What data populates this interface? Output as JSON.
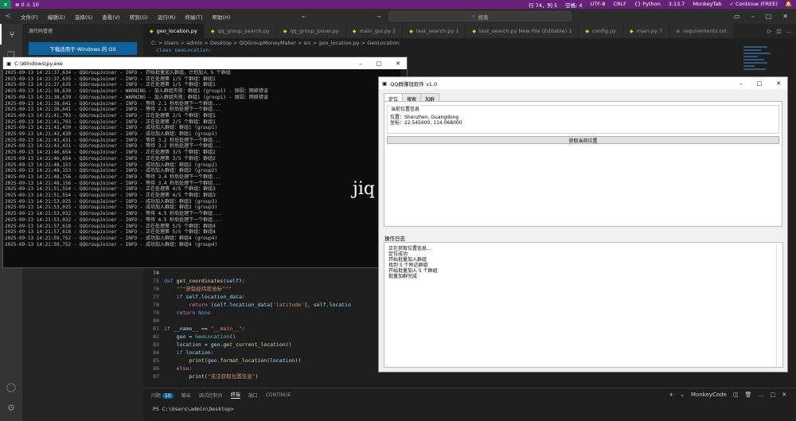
{
  "statusbar": {
    "left": [
      "⊗ 0 ⚠ 10"
    ],
    "right": [
      "行 74，列 5",
      "空格: 4",
      "UTF-8",
      "CRLF",
      "{} Python",
      "3.13.7",
      "MonkeyTab",
      "✓ Continue (FREE)",
      "🔔"
    ]
  },
  "titlebar": {
    "menus": [
      "文件(F)",
      "编辑(E)",
      "选择(S)",
      "查看(V)",
      "转到(G)",
      "运行(R)",
      "终端(T)",
      "帮助(H)"
    ],
    "search_text": "搜索",
    "nav_back": "←",
    "nav_forward": "→"
  },
  "sidebar": {
    "title": "源代码管理",
    "git_button": "下载适用于 Windows 的 Git"
  },
  "tabs": [
    {
      "label": "geo_location.py",
      "active": true,
      "icon": "python-icon"
    },
    {
      "label": "qq_group_search.py",
      "active": false,
      "icon": "python-icon"
    },
    {
      "label": "qq_group_joiner.py",
      "active": false,
      "icon": "python-icon"
    },
    {
      "label": "main_gui.py 2",
      "active": false,
      "icon": "python-icon"
    },
    {
      "label": "test_search.py 1",
      "active": false,
      "icon": "python-icon"
    },
    {
      "label": "test_search.py New File (Editable) 1",
      "active": false,
      "icon": "python-icon"
    },
    {
      "label": "config.py",
      "active": false,
      "icon": "python-icon"
    },
    {
      "label": "main.py 7",
      "active": false,
      "icon": "python-icon"
    },
    {
      "label": "requirements.txt",
      "active": false,
      "icon": "file-icon"
    }
  ],
  "breadcrumb": "C: > Users > admin > Desktop > QQGroupMoneyMaker > src > geo_location.py > GeoLocation",
  "code_top": "class GeoLocation:",
  "editor_lines": [
    {
      "num": "74",
      "html": ""
    },
    {
      "num": "75",
      "html": "<span class=\"k-def\">def</span> <span class=\"k-fn\">get_coordinates</span>(<span class=\"k-var\">self</span>):"
    },
    {
      "num": "76",
      "html": "    <span class=\"k-str\">\"\"\"获取经纬度坐标\"\"\"</span>"
    },
    {
      "num": "77",
      "html": "    <span class=\"k-ctl\">if</span> <span class=\"k-var\">self</span>.<span class=\"k-var\">location_data</span>:"
    },
    {
      "num": "78",
      "html": "        <span class=\"k-ctl\">return</span> (<span class=\"k-var\">self</span>.<span class=\"k-var\">location_data</span>[<span class=\"k-str\">'latitude'</span>], <span class=\"k-var\">self</span>.<span class=\"k-var\">locatio</span>"
    },
    {
      "num": "79",
      "html": "    <span class=\"k-ctl\">return</span> <span class=\"k-def\">None</span>"
    },
    {
      "num": "80",
      "html": ""
    },
    {
      "num": "81",
      "html": "<span class=\"k-ctl\">if</span> <span class=\"k-var\">__name__</span> == <span class=\"k-str\">\"__main__\"</span>:"
    },
    {
      "num": "82",
      "html": "    <span class=\"k-var\">geo</span> = <span class=\"k-cls\">GeoLocation</span>()"
    },
    {
      "num": "83",
      "html": "    <span class=\"k-var\">location</span> = <span class=\"k-var\">geo</span>.<span class=\"k-fn\">get_current_location</span>()"
    },
    {
      "num": "84",
      "html": "    <span class=\"k-ctl\">if</span> <span class=\"k-var\">location</span>:"
    },
    {
      "num": "85",
      "html": "        <span class=\"k-fn\">print</span>(<span class=\"k-var\">geo</span>.<span class=\"k-fn\">format_location</span>(<span class=\"k-var\">location</span>))"
    },
    {
      "num": "86",
      "html": "    <span class=\"k-ctl\">else</span>:"
    },
    {
      "num": "87",
      "html": "        <span class=\"k-fn\">print</span>(<span class=\"k-str\">\"无法获取位置信息\"</span>)"
    }
  ],
  "panel": {
    "tabs": [
      "问题",
      "输出",
      "调试控制台",
      "终端",
      "端口",
      "CONTINUE"
    ],
    "problems_badge": "10",
    "active_tab": 3,
    "right_label": "MonkeyCode",
    "prompt": "PS C:\\Users\\admin\\Desktop>"
  },
  "console": {
    "title": "C:\\Windows\\py.exe",
    "lines": [
      "2025-09-13 14:21:37,634 - QQGroupJoiner - INFO - 开始批量加入群组，计划加入 5 个群组",
      "2025-09-13 14:21:37,635 - QQGroupJoiner - INFO - 正在处理第 1/5 个群组：群组1",
      "2025-09-13 14:21:37,635 - QQGroupJoiner - INFO - 正在处理第 1/5 个群组：群组1",
      "2025-09-13 14:21:38,639 - QQGroupJoiner - WARNING - 加入群组失败：群组1 (group1) - 原因：网络错误",
      "2025-09-13 14:21:38,639 - QQGroupJoiner - WARNING - 加入群组失败：群组1 (group1) - 原因：网络错误",
      "2025-09-13 14:21:38,641 - QQGroupJoiner - INFO - 等待 2.1 秒后处理下一个群组...",
      "2025-09-13 14:21:38,641 - QQGroupJoiner - INFO - 等待 2.1 秒后处理下一个群组...",
      "2025-09-13 14:21:41,793 - QQGroupJoiner - INFO - 正在处理第 2/5 个群组：群组1",
      "2025-09-13 14:21:41,793 - QQGroupJoiner - INFO - 正在处理第 2/5 个群组：群组1",
      "2025-09-13 14:21:43,430 - QQGroupJoiner - INFO - 成功加入群组：群组1 (group1)",
      "2025-09-13 14:21:43,430 - QQGroupJoiner - INFO - 成功加入群组：群组1 (group1)",
      "2025-09-13 14:21:43,431 - QQGroupJoiner - INFO - 等待 3.2 秒后处理下一个群组...",
      "2025-09-13 14:21:43,431 - QQGroupJoiner - INFO - 等待 3.2 秒后处理下一个群组...",
      "2025-09-13 14:21:46,654 - QQGroupJoiner - INFO - 正在处理第 3/5 个群组：群组2",
      "2025-09-13 14:21:46,654 - QQGroupJoiner - INFO - 正在处理第 3/5 个群组：群组2",
      "2025-09-13 14:21:48,153 - QQGroupJoiner - INFO - 成功加入群组：群组2 (group2)",
      "2025-09-13 14:21:48,153 - QQGroupJoiner - INFO - 成功加入群组：群组2 (group2)",
      "2025-09-13 14:21:48,156 - QQGroupJoiner - INFO - 等待 3.4 秒后处理下一个群组...",
      "2025-09-13 14:21:48,156 - QQGroupJoiner - INFO - 等待 3.4 秒后处理下一个群组...",
      "2025-09-13 14:21:51,554 - QQGroupJoiner - INFO - 正在处理第 4/5 个群组：群组3",
      "2025-09-13 14:21:51,554 - QQGroupJoiner - INFO - 正在处理第 4/5 个群组：群组3",
      "2025-09-13 14:21:53,025 - QQGroupJoiner - INFO - 成功加入群组：群组3 (group3)",
      "2025-09-13 14:21:53,025 - QQGroupJoiner - INFO - 成功加入群组：群组3 (group3)",
      "2025-09-13 14:21:53,032 - QQGroupJoiner - INFO - 等待 4.5 秒后处理下一个群组...",
      "2025-09-13 14:21:53,032 - QQGroupJoiner - INFO - 等待 4.5 秒后处理下一个群组...",
      "2025-09-13 14:21:57,618 - QQGroupJoiner - INFO - 正在处理第 5/5 个群组：群组4",
      "2025-09-13 14:21:57,618 - QQGroupJoiner - INFO - 正在处理第 5/5 个群组：群组4",
      "2025-09-13 14:21:59,752 - QQGroupJoiner - INFO - 成功加入群组：群组4 (group4)",
      "2025-09-13 14:21:59,752 - QQGroupJoiner - INFO - 成功加入群组：群组4 (group4)"
    ]
  },
  "app": {
    "title": "QQ群赚钱软件 v1.0",
    "tabs": [
      "定位",
      "搜索",
      "加群"
    ],
    "active_tab": 0,
    "group_title": "当前位置信息",
    "location_line": "位置：Shenzhen, Guangdong",
    "coords_line": "坐标：22.545600, 114.068000",
    "locate_button": "获取当前位置",
    "log_title": "操作日志",
    "log_lines": [
      "正在获取位置信息...",
      "定位成功",
      "开始批量加入群组",
      "找到 5 个附近群组",
      "开始批量加入 5 个群组",
      "批量加群完成"
    ]
  },
  "watermark": "jiq"
}
